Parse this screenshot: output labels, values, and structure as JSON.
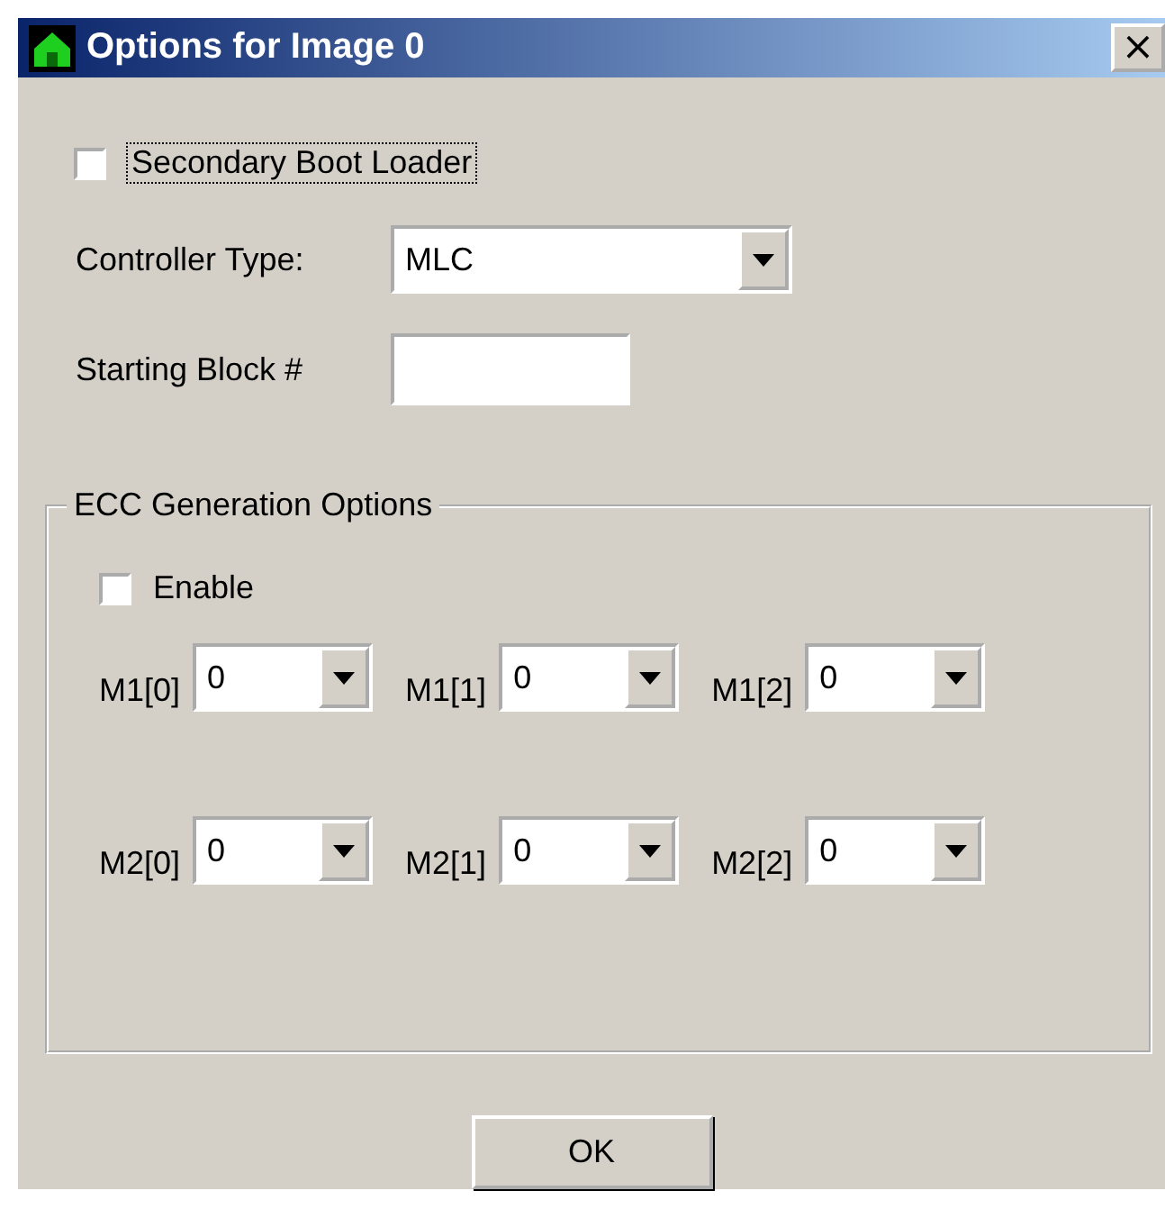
{
  "window": {
    "title": "Options for Image 0",
    "close": "×"
  },
  "secondary_boot_loader": {
    "label": "Secondary Boot Loader",
    "checked": false,
    "focused": true
  },
  "controller_type": {
    "label": "Controller Type:",
    "value": "MLC"
  },
  "starting_block": {
    "label": "Starting Block #"
  },
  "ecc": {
    "title": "ECC Generation Options",
    "enable": {
      "label": "Enable",
      "checked": false
    },
    "rows": [
      [
        {
          "label": "M1[0]",
          "value": "0"
        },
        {
          "label": "M1[1]",
          "value": "0"
        },
        {
          "label": "M1[2]",
          "value": "0"
        }
      ],
      [
        {
          "label": "M2[0]",
          "value": "0"
        },
        {
          "label": "M2[1]",
          "value": "0"
        },
        {
          "label": "M2[2]",
          "value": "0"
        }
      ]
    ]
  },
  "buttons": [
    {
      "label": "OK"
    }
  ]
}
